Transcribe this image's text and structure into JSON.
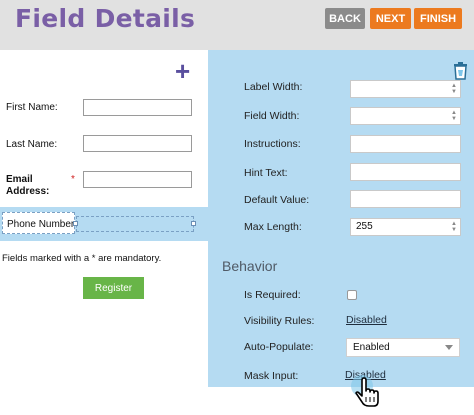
{
  "header": {
    "title": "Field Details",
    "back_label": "BACK",
    "next_label": "NEXT",
    "finish_label": "FINISH"
  },
  "form": {
    "add_symbol": "+",
    "fields": [
      {
        "label": "First Name:",
        "value": ""
      },
      {
        "label": "Last Name:",
        "value": ""
      },
      {
        "label": "Email Address:",
        "required_mark": "*",
        "value": ""
      },
      {
        "label": "Phone Number",
        "value": ""
      }
    ],
    "mandatory_note": "Fields marked with a * are mandatory.",
    "register_label": "Register"
  },
  "properties": {
    "label_width": {
      "label": "Label Width:",
      "value": ""
    },
    "field_width": {
      "label": "Field Width:",
      "value": ""
    },
    "instructions": {
      "label": "Instructions:",
      "value": ""
    },
    "hint_text": {
      "label": "Hint Text:",
      "value": ""
    },
    "default_value": {
      "label": "Default Value:",
      "value": ""
    },
    "max_length": {
      "label": "Max Length:",
      "value": "255"
    }
  },
  "behavior": {
    "heading": "Behavior",
    "is_required": {
      "label": "Is Required:",
      "checked": false
    },
    "visibility_rules": {
      "label": "Visibility Rules:",
      "value": "Disabled"
    },
    "auto_populate": {
      "label": "Auto-Populate:",
      "value": "Enabled"
    },
    "mask_input": {
      "label": "Mask Input:",
      "value": "Disabled"
    }
  },
  "icons": [
    "plus-icon",
    "trash-icon",
    "hand-cursor-icon",
    "spinner-arrows-icon",
    "dropdown-caret-icon"
  ],
  "colors": {
    "title": "#7a5fa6",
    "header_bg": "#e1e1e1",
    "back_button": "#8b8b8b",
    "orange_button": "#ec7a1f",
    "panel_bg": "#b5dbf2",
    "register_button": "#68b548"
  }
}
